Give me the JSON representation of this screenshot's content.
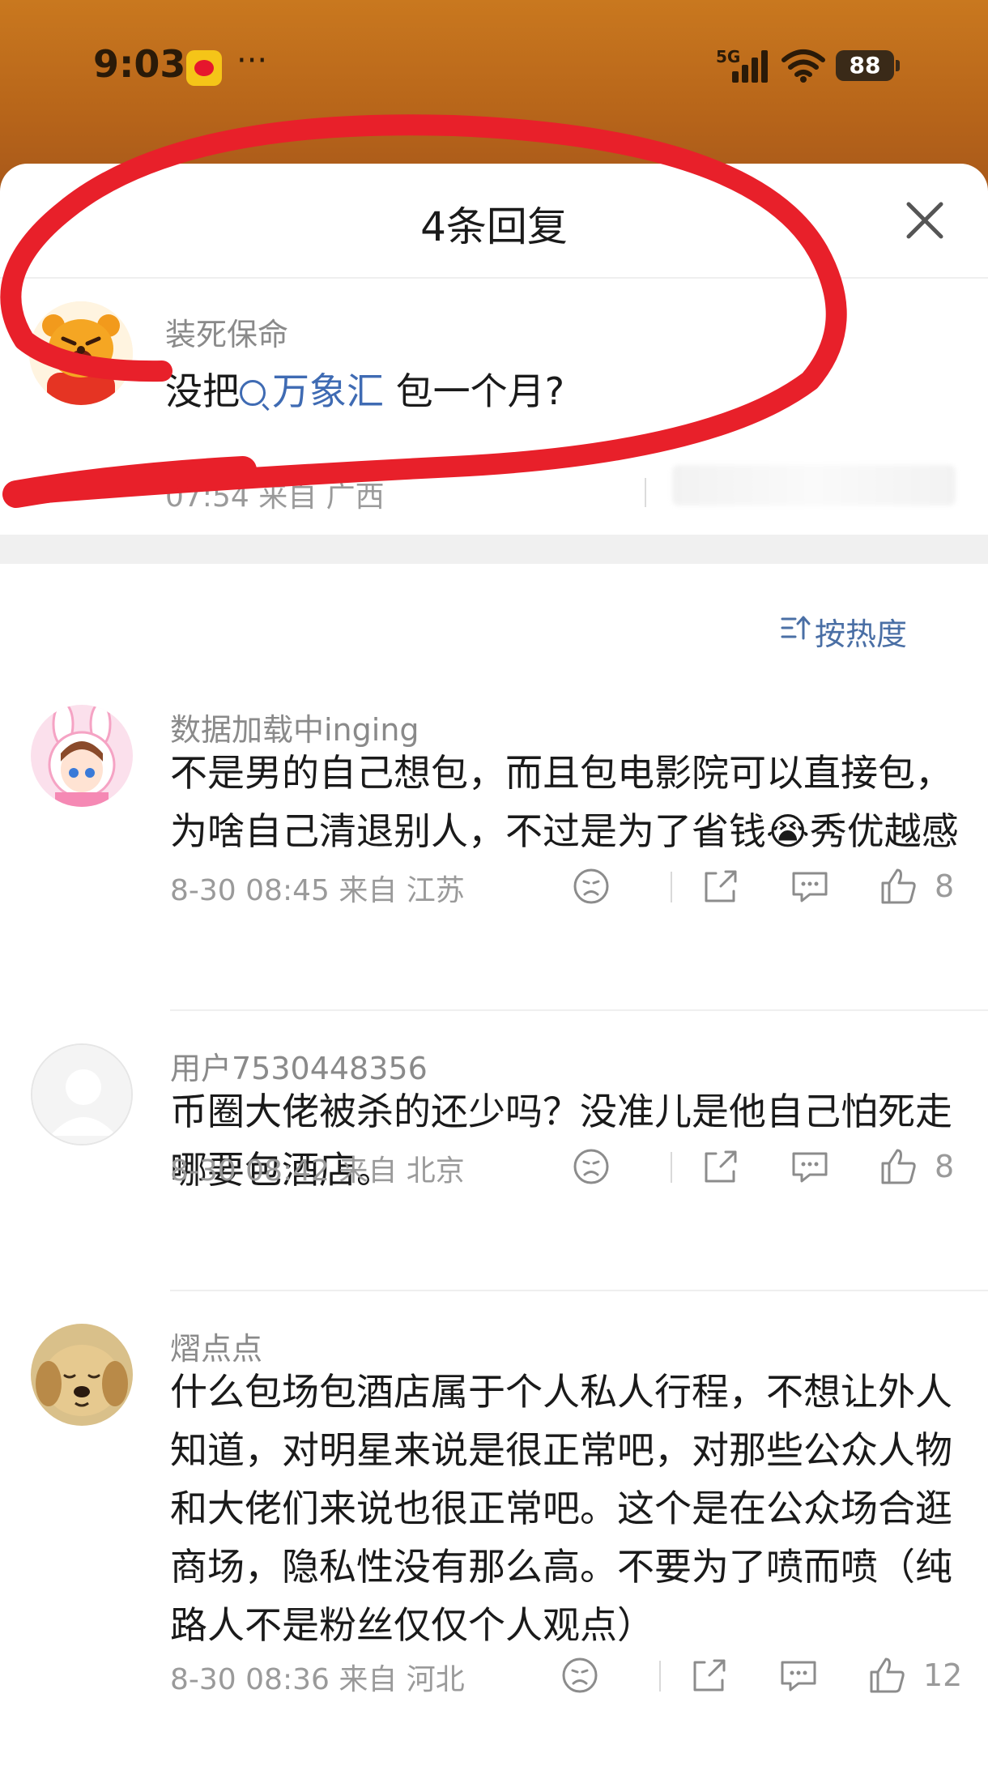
{
  "status_bar": {
    "time": "9:03",
    "more": "···",
    "network": "5G",
    "battery": "88"
  },
  "sheet": {
    "title": "4条回复"
  },
  "original_post": {
    "user": "装死保命",
    "text_before": "没把",
    "topic": "万象汇",
    "text_after": " 包一个月?",
    "meta": "07:54 来自 广西"
  },
  "sort": {
    "label": "按热度"
  },
  "replies": [
    {
      "user": "数据加载中inging",
      "text": "不是男的自己想包，而且包电影院可以直接包，为啥自己清退别人，不过是为了省钱😭秀优越感",
      "meta": "8-30 08:45  来自 江苏",
      "likes": "8"
    },
    {
      "user": "用户7530448356",
      "text": "币圈大佬被杀的还少吗？没准儿是他自己怕死走哪要包酒店。",
      "meta": "8-30 08:42  来自 北京",
      "likes": "8"
    },
    {
      "user": "熠点点",
      "text": "什么包场包酒店属于个人私人行程，不想让外人知道，对明星来说是很正常吧，对那些公众人物和大佬们来说也很正常吧。这个是在公众场合逛商场，隐私性没有那么高。不要为了喷而喷（纯路人不是粉丝仅仅个人观点）",
      "meta": "8-30 08:36  来自 河北",
      "likes": "12"
    }
  ],
  "colors": {
    "link": "#3f6bb3",
    "annotation": "#e8202a",
    "background_top": "#c9781f"
  }
}
